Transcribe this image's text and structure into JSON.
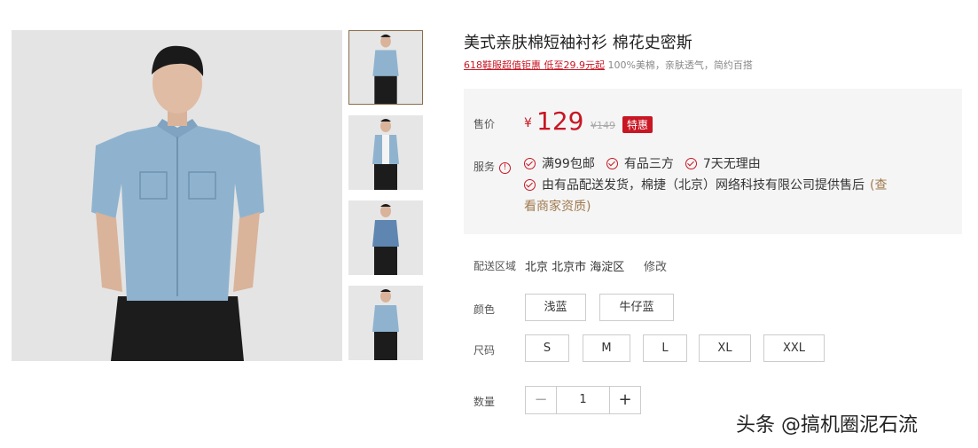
{
  "product": {
    "title": "美式亲肤棉短袖衬衫 棉花史密斯",
    "promo_link": "618鞋服超值钜惠 低至29.9元起",
    "promo_desc": "100%美棉，亲肤透气，简约百搭"
  },
  "price": {
    "label": "售价",
    "currency": "¥",
    "value": "129",
    "original": "¥149",
    "badge": "特惠"
  },
  "service": {
    "label": "服务",
    "info_icon": "!",
    "items": [
      "满99包邮",
      "有品三方",
      "7天无理由"
    ],
    "seller": "由有品配送发货，棉捷（北京）网络科技有限公司提供售后",
    "seller_link_1": "(查",
    "seller_link_2": "看商家资质)"
  },
  "delivery": {
    "label": "配送区域",
    "region": "北京 北京市 海淀区",
    "modify": "修改"
  },
  "color": {
    "label": "颜色",
    "options": [
      "浅蓝",
      "牛仔蓝"
    ]
  },
  "size": {
    "label": "尺码",
    "options": [
      "S",
      "M",
      "L",
      "XL",
      "XXL"
    ]
  },
  "quantity": {
    "label": "数量",
    "minus": "−",
    "value": "1",
    "plus": "+"
  },
  "watermark": "头条 @搞机圈泥石流",
  "colors": {
    "accent": "#c81623",
    "brown": "#a07a4f",
    "shirt": "#8fb3cf",
    "pants": "#1c1c1c"
  }
}
